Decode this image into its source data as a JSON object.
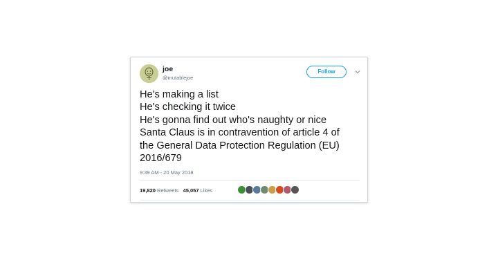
{
  "user": {
    "display_name": "joe",
    "handle": "@mutablejoe"
  },
  "follow_label": "Follow",
  "tweet": {
    "lines": [
      "He's making a list",
      "He's checking it twice",
      "He's gonna find out who's naughty or nice",
      "Santa Claus is in contravention of article 4 of",
      "the General Data Protection Regulation (EU)",
      "2016/679"
    ],
    "timestamp": "9:39 AM - 20 May 2018"
  },
  "stats": {
    "retweets_count": "19,820",
    "retweets_label": "Retweets",
    "likes_count": "45,057",
    "likes_label": "Likes"
  },
  "likers": [
    {
      "color": "#3f8f3a"
    },
    {
      "color": "#4a4f58"
    },
    {
      "color": "#5b7a9a"
    },
    {
      "color": "#6f8a70"
    },
    {
      "color": "#c9a04a"
    },
    {
      "color": "#d84a1f"
    },
    {
      "color": "#b35a6a"
    },
    {
      "color": "#555555"
    }
  ],
  "colors": {
    "accent": "#1da1f2",
    "text": "#14171a",
    "secondary_text": "#657786",
    "avatar_bg": "#c9cf94"
  }
}
